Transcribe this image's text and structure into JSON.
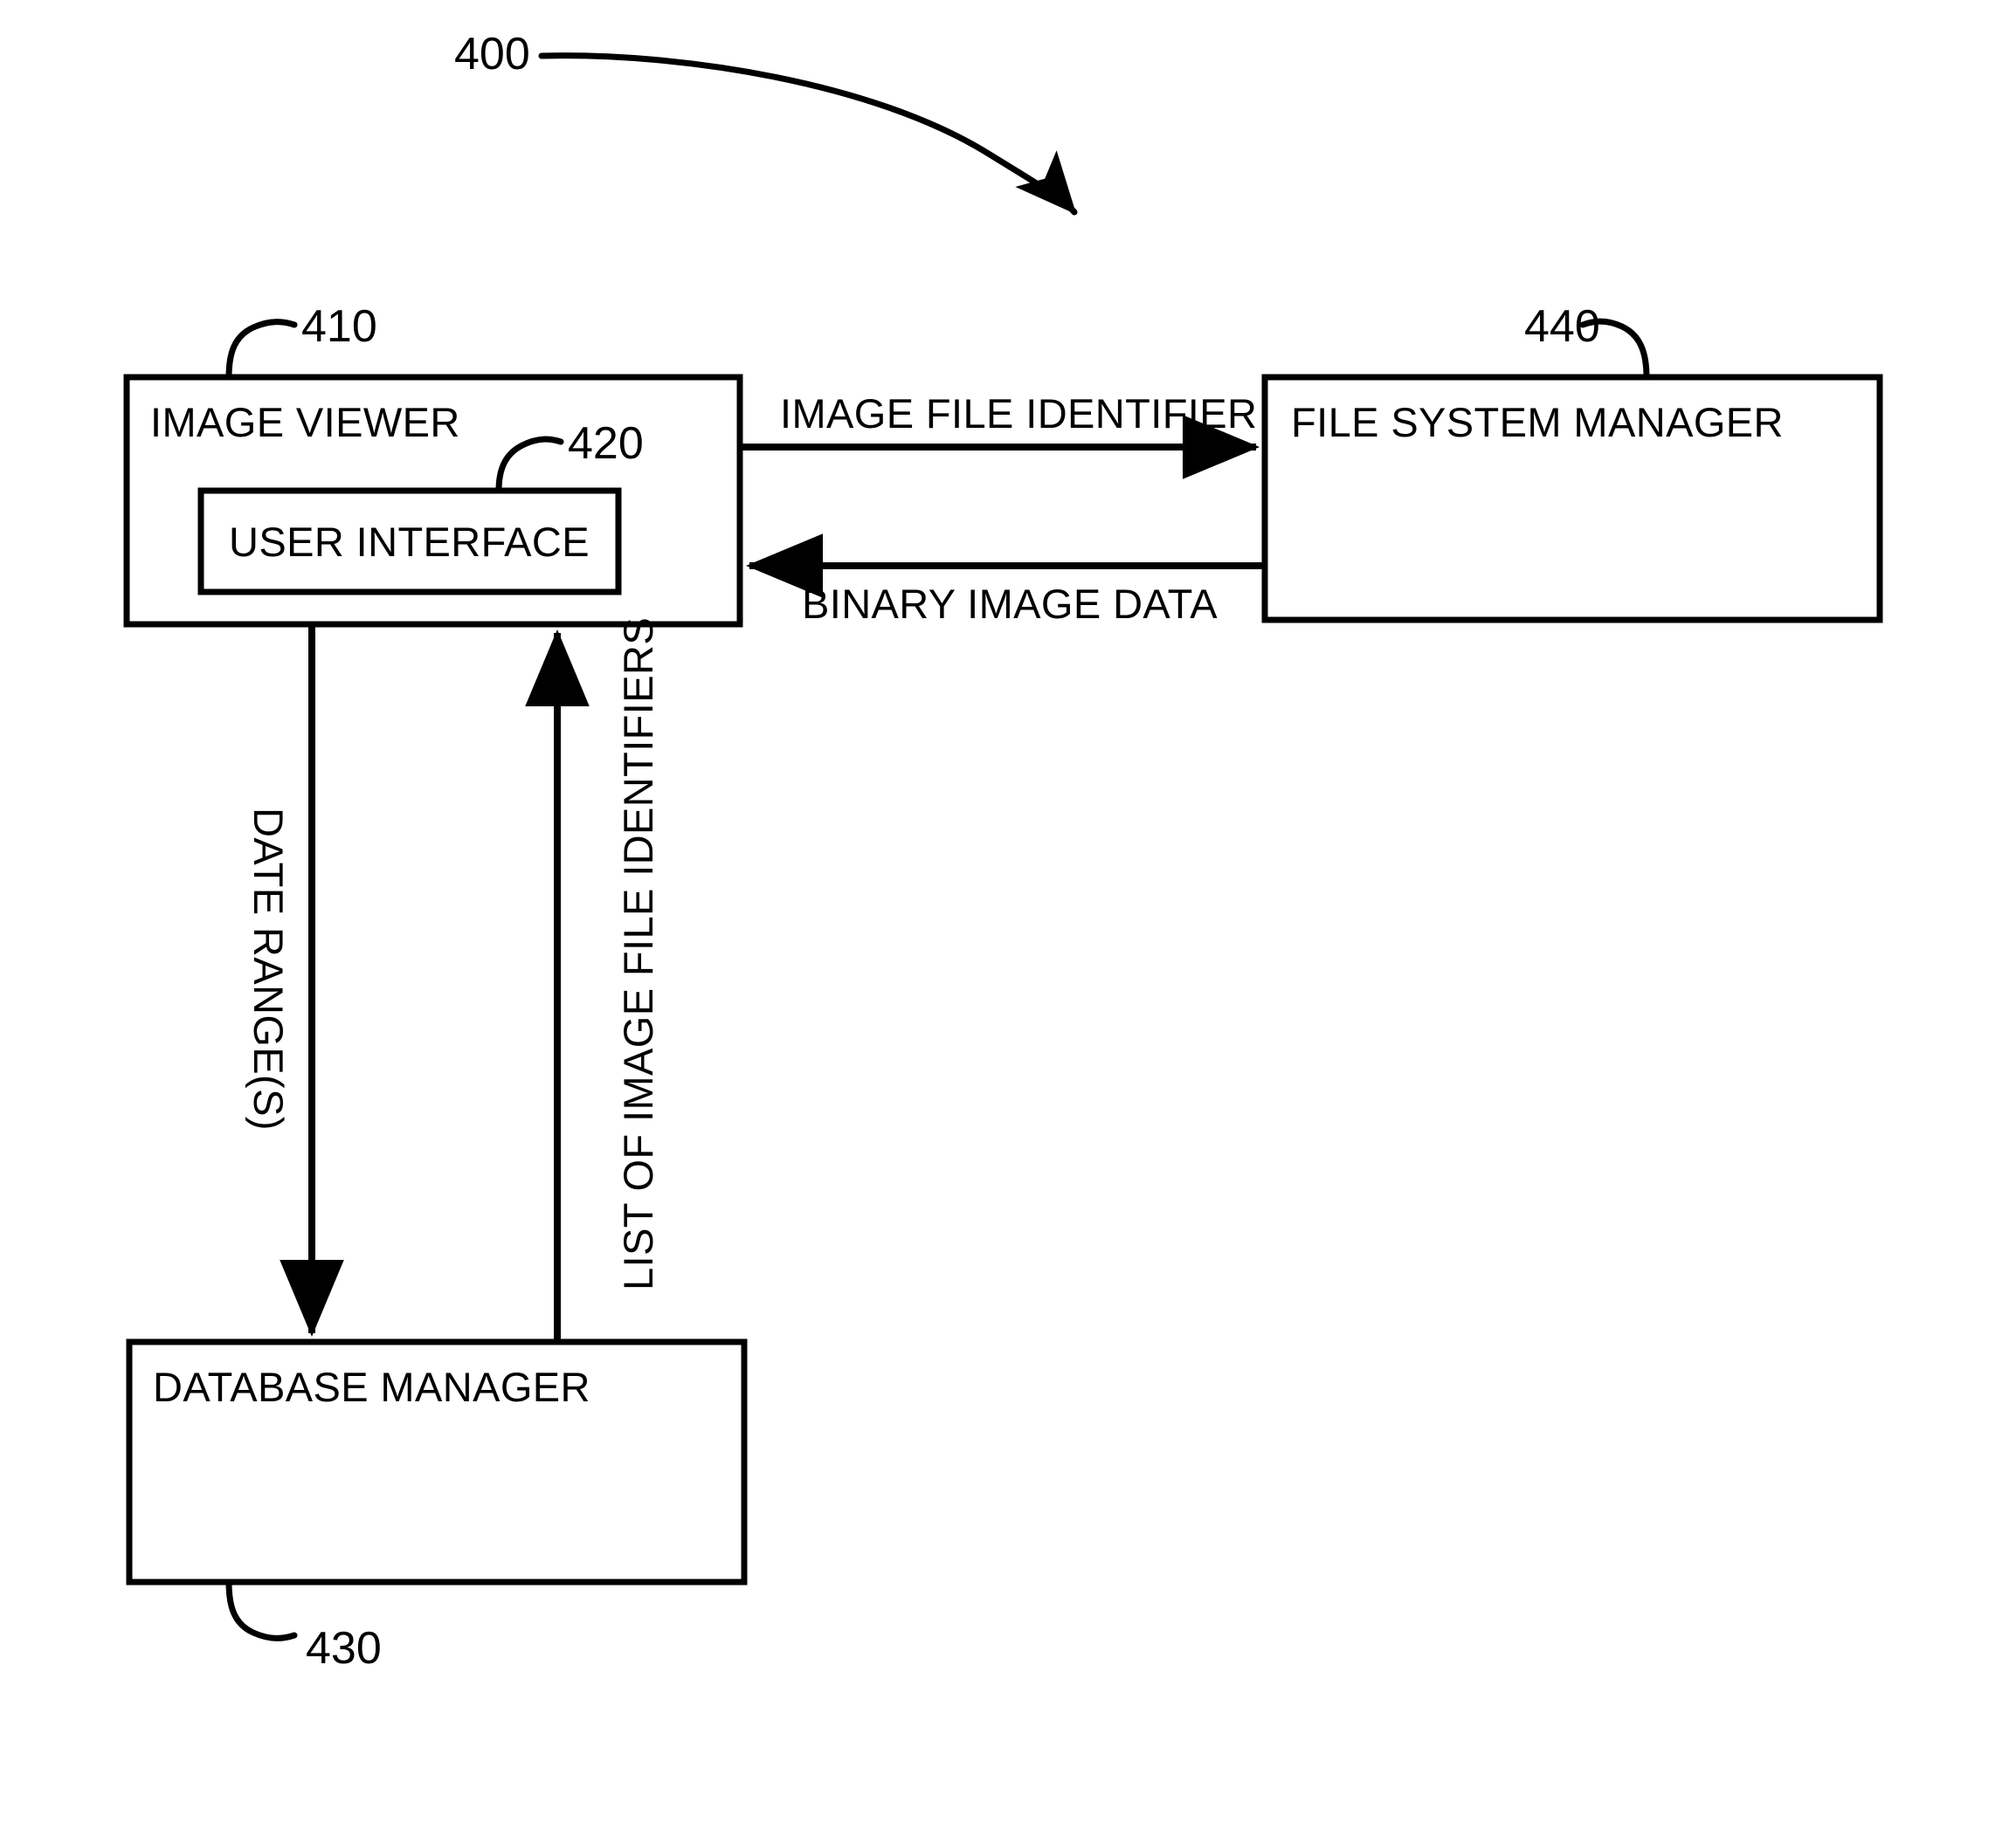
{
  "figure": {
    "reference_number": "400"
  },
  "nodes": [
    {
      "id": "image-viewer",
      "label": "IMAGE VIEWER",
      "reference_number": "410"
    },
    {
      "id": "user-interface",
      "label": "USER INTERFACE",
      "reference_number": "420"
    },
    {
      "id": "database-manager",
      "label": "DATABASE MANAGER",
      "reference_number": "430"
    },
    {
      "id": "file-system-manager",
      "label": "FILE SYSTEM MANAGER",
      "reference_number": "440"
    }
  ],
  "edges": [
    {
      "id": "image-file-identifier",
      "label": "IMAGE FILE IDENTIFIER",
      "from": "image-viewer",
      "to": "file-system-manager",
      "orientation": "horizontal"
    },
    {
      "id": "binary-image-data",
      "label": "BINARY IMAGE DATA",
      "from": "file-system-manager",
      "to": "image-viewer",
      "orientation": "horizontal"
    },
    {
      "id": "date-ranges",
      "label": "DATE RANGE(S)",
      "from": "image-viewer",
      "to": "database-manager",
      "orientation": "vertical"
    },
    {
      "id": "list-of-image-file-identifiers",
      "label": "LIST OF IMAGE FILE IDENTIFIERS",
      "from": "database-manager",
      "to": "image-viewer",
      "orientation": "vertical"
    }
  ],
  "colors": {
    "stroke": "#000000",
    "background": "#ffffff"
  }
}
